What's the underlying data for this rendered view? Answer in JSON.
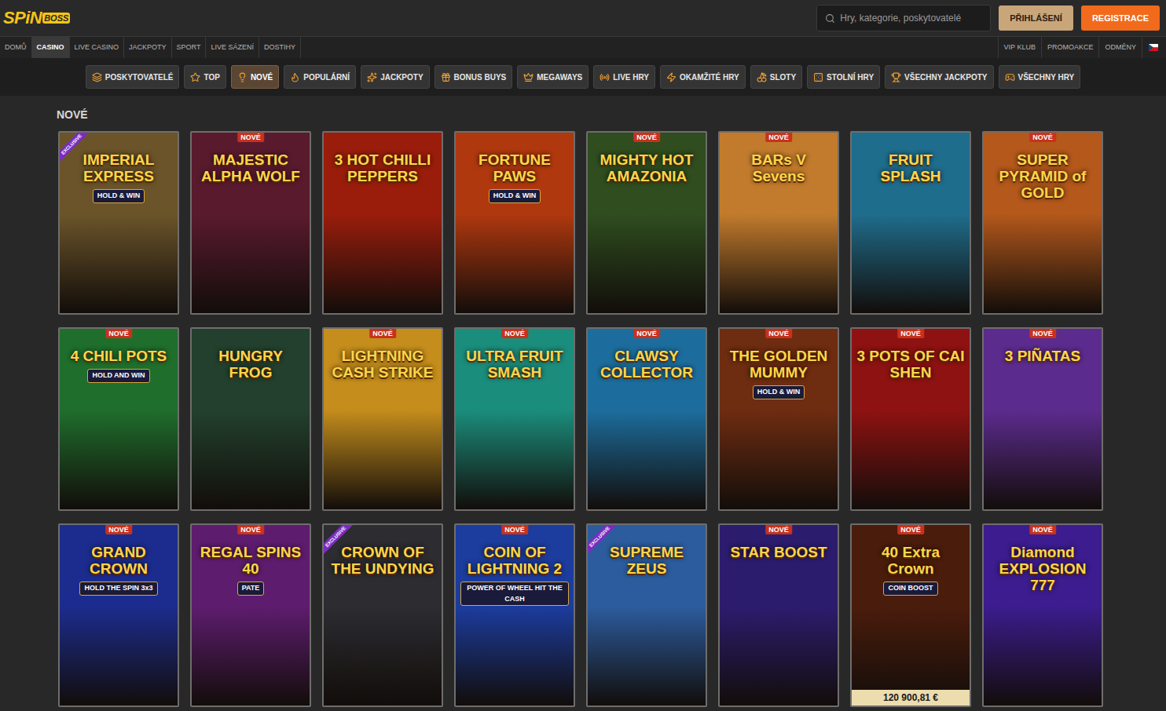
{
  "header": {
    "logo": {
      "text": "SPiN",
      "badge": "BOSS"
    },
    "search": {
      "placeholder": "Hry, kategorie, poskytovatelé"
    },
    "buttons": [
      {
        "label": "PŘIHLÁŠENÍ",
        "color": "#c9a67a"
      },
      {
        "label": "REGISTRACE",
        "color": "#f26a1b"
      }
    ]
  },
  "main_nav": [
    {
      "label": "DOMŮ",
      "selected": false
    },
    {
      "label": "CASINO",
      "selected": true
    },
    {
      "label": "LIVE CASINO",
      "selected": false
    },
    {
      "label": "JACKPOTY",
      "selected": false
    },
    {
      "label": "SPORT",
      "selected": false
    },
    {
      "label": "LIVE SÁZENÍ",
      "selected": false
    },
    {
      "label": "DOSTIHY",
      "selected": false
    }
  ],
  "secondary_nav": [
    "VIP KLUB",
    "PROMOAKCE",
    "ODMĚNY"
  ],
  "categories": [
    {
      "label": "POSKYTOVATELÉ",
      "selected": false
    },
    {
      "label": "TOP",
      "selected": false
    },
    {
      "label": "NOVÉ",
      "selected": true
    },
    {
      "label": "POPULÁRNÍ",
      "selected": false
    },
    {
      "label": "JACKPOTY",
      "selected": false
    },
    {
      "label": "BONUS BUYS",
      "selected": false
    },
    {
      "label": "MEGAWAYS",
      "selected": false
    },
    {
      "label": "LIVE HRY",
      "selected": false
    },
    {
      "label": "OKAMŽITÉ HRY",
      "selected": false
    },
    {
      "label": "SLOTY",
      "selected": false
    },
    {
      "label": "STOLNÍ HRY",
      "selected": false
    },
    {
      "label": "VŠECHNY JACKPOTY",
      "selected": false
    },
    {
      "label": "VŠECHNY HRY",
      "selected": false
    }
  ],
  "section": {
    "title": "NOVÉ"
  },
  "games": [
    {
      "title": "IMPERIAL EXPRESS",
      "subtitle": "HOLD & WIN",
      "badge": "EXCLUSIVE",
      "jackpot": "",
      "color": "#6b5429"
    },
    {
      "title": "MAJESTIC ALPHA WOLF",
      "subtitle": "",
      "badge": "NOVÉ",
      "jackpot": "",
      "color": "#5a1a2e"
    },
    {
      "title": "3 HOT CHILLI PEPPERS",
      "subtitle": "",
      "badge": "",
      "jackpot": "",
      "color": "#9a1d0c"
    },
    {
      "title": "FORTUNE PAWS",
      "subtitle": "HOLD & WIN",
      "badge": "",
      "jackpot": "",
      "color": "#b0380f"
    },
    {
      "title": "MIGHTY HOT AMAZONIA",
      "subtitle": "",
      "badge": "NOVÉ",
      "jackpot": "",
      "color": "#2f4d1f"
    },
    {
      "title": "BARs V Sevens",
      "subtitle": "",
      "badge": "NOVÉ",
      "jackpot": "",
      "color": "#c27b2c"
    },
    {
      "title": "FRUIT SPLASH",
      "subtitle": "",
      "badge": "",
      "jackpot": "",
      "color": "#1f6d8c"
    },
    {
      "title": "SUPER PYRAMID of GOLD",
      "subtitle": "",
      "badge": "NOVÉ",
      "jackpot": "",
      "color": "#b4581b"
    },
    {
      "title": "4 CHILI POTS",
      "subtitle": "HOLD AND WIN",
      "badge": "NOVÉ",
      "jackpot": "",
      "color": "#1f6e2c"
    },
    {
      "title": "HUNGRY FROG",
      "subtitle": "",
      "badge": "",
      "jackpot": "",
      "color": "#22402d"
    },
    {
      "title": "LIGHTNING CASH STRIKE",
      "subtitle": "",
      "badge": "NOVÉ",
      "jackpot": "",
      "color": "#c48d1c"
    },
    {
      "title": "ULTRA FRUIT SMASH",
      "subtitle": "",
      "badge": "NOVÉ",
      "jackpot": "",
      "color": "#1b8d7c"
    },
    {
      "title": "CLAWSY COLLECTOR",
      "subtitle": "",
      "badge": "NOVÉ",
      "jackpot": "",
      "color": "#1c6d9d"
    },
    {
      "title": "THE GOLDEN MUMMY",
      "subtitle": "HOLD & WIN",
      "badge": "NOVÉ",
      "jackpot": "",
      "color": "#6e2c11"
    },
    {
      "title": "3 POTS OF CAI SHEN",
      "subtitle": "",
      "badge": "NOVÉ",
      "jackpot": "",
      "color": "#8e1212"
    },
    {
      "title": "3 PIÑATAS",
      "subtitle": "",
      "badge": "NOVÉ",
      "jackpot": "",
      "color": "#5c2b8e"
    },
    {
      "title": "GRAND CROWN",
      "subtitle": "HOLD THE SPIN 3x3",
      "badge": "NOVÉ",
      "jackpot": "",
      "color": "#1c2c8e"
    },
    {
      "title": "REGAL SPINS 40",
      "subtitle": "PATE",
      "badge": "NOVÉ",
      "jackpot": "",
      "color": "#5e1c6e"
    },
    {
      "title": "CROWN OF THE UNDYING",
      "subtitle": "",
      "badge": "EXCLUSIVE",
      "jackpot": "",
      "color": "#2c2c31"
    },
    {
      "title": "COIN OF LIGHTNING 2",
      "subtitle": "POWER OF WHEEL HIT THE CASH",
      "badge": "NOVÉ",
      "jackpot": "",
      "color": "#1c3c9e"
    },
    {
      "title": "SUPREME ZEUS",
      "subtitle": "",
      "badge": "EXCLUSIVE",
      "jackpot": "",
      "color": "#2c5c9e"
    },
    {
      "title": "STAR BOOST",
      "subtitle": "",
      "badge": "NOVÉ",
      "jackpot": "",
      "color": "#2c1c6e"
    },
    {
      "title": "40 Extra Crown",
      "subtitle": "COIN BOOST",
      "badge": "NOVÉ",
      "jackpot": "120 900,81 €",
      "color": "#4a1c0c"
    },
    {
      "title": "Diamond EXPLOSION 777",
      "subtitle": "",
      "badge": "NOVÉ",
      "jackpot": "",
      "color": "#3c1c8e"
    }
  ]
}
